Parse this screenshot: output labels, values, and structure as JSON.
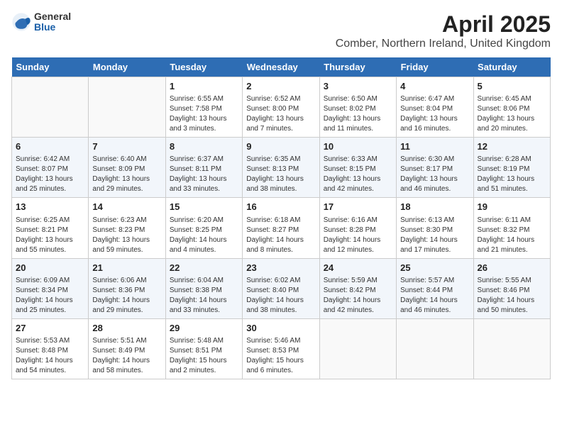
{
  "header": {
    "logo_general": "General",
    "logo_blue": "Blue",
    "title": "April 2025",
    "subtitle": "Comber, Northern Ireland, United Kingdom"
  },
  "days_of_week": [
    "Sunday",
    "Monday",
    "Tuesday",
    "Wednesday",
    "Thursday",
    "Friday",
    "Saturday"
  ],
  "weeks": [
    [
      {
        "day": "",
        "info": ""
      },
      {
        "day": "",
        "info": ""
      },
      {
        "day": "1",
        "info": "Sunrise: 6:55 AM\nSunset: 7:58 PM\nDaylight: 13 hours and 3 minutes."
      },
      {
        "day": "2",
        "info": "Sunrise: 6:52 AM\nSunset: 8:00 PM\nDaylight: 13 hours and 7 minutes."
      },
      {
        "day": "3",
        "info": "Sunrise: 6:50 AM\nSunset: 8:02 PM\nDaylight: 13 hours and 11 minutes."
      },
      {
        "day": "4",
        "info": "Sunrise: 6:47 AM\nSunset: 8:04 PM\nDaylight: 13 hours and 16 minutes."
      },
      {
        "day": "5",
        "info": "Sunrise: 6:45 AM\nSunset: 8:06 PM\nDaylight: 13 hours and 20 minutes."
      }
    ],
    [
      {
        "day": "6",
        "info": "Sunrise: 6:42 AM\nSunset: 8:07 PM\nDaylight: 13 hours and 25 minutes."
      },
      {
        "day": "7",
        "info": "Sunrise: 6:40 AM\nSunset: 8:09 PM\nDaylight: 13 hours and 29 minutes."
      },
      {
        "day": "8",
        "info": "Sunrise: 6:37 AM\nSunset: 8:11 PM\nDaylight: 13 hours and 33 minutes."
      },
      {
        "day": "9",
        "info": "Sunrise: 6:35 AM\nSunset: 8:13 PM\nDaylight: 13 hours and 38 minutes."
      },
      {
        "day": "10",
        "info": "Sunrise: 6:33 AM\nSunset: 8:15 PM\nDaylight: 13 hours and 42 minutes."
      },
      {
        "day": "11",
        "info": "Sunrise: 6:30 AM\nSunset: 8:17 PM\nDaylight: 13 hours and 46 minutes."
      },
      {
        "day": "12",
        "info": "Sunrise: 6:28 AM\nSunset: 8:19 PM\nDaylight: 13 hours and 51 minutes."
      }
    ],
    [
      {
        "day": "13",
        "info": "Sunrise: 6:25 AM\nSunset: 8:21 PM\nDaylight: 13 hours and 55 minutes."
      },
      {
        "day": "14",
        "info": "Sunrise: 6:23 AM\nSunset: 8:23 PM\nDaylight: 13 hours and 59 minutes."
      },
      {
        "day": "15",
        "info": "Sunrise: 6:20 AM\nSunset: 8:25 PM\nDaylight: 14 hours and 4 minutes."
      },
      {
        "day": "16",
        "info": "Sunrise: 6:18 AM\nSunset: 8:27 PM\nDaylight: 14 hours and 8 minutes."
      },
      {
        "day": "17",
        "info": "Sunrise: 6:16 AM\nSunset: 8:28 PM\nDaylight: 14 hours and 12 minutes."
      },
      {
        "day": "18",
        "info": "Sunrise: 6:13 AM\nSunset: 8:30 PM\nDaylight: 14 hours and 17 minutes."
      },
      {
        "day": "19",
        "info": "Sunrise: 6:11 AM\nSunset: 8:32 PM\nDaylight: 14 hours and 21 minutes."
      }
    ],
    [
      {
        "day": "20",
        "info": "Sunrise: 6:09 AM\nSunset: 8:34 PM\nDaylight: 14 hours and 25 minutes."
      },
      {
        "day": "21",
        "info": "Sunrise: 6:06 AM\nSunset: 8:36 PM\nDaylight: 14 hours and 29 minutes."
      },
      {
        "day": "22",
        "info": "Sunrise: 6:04 AM\nSunset: 8:38 PM\nDaylight: 14 hours and 33 minutes."
      },
      {
        "day": "23",
        "info": "Sunrise: 6:02 AM\nSunset: 8:40 PM\nDaylight: 14 hours and 38 minutes."
      },
      {
        "day": "24",
        "info": "Sunrise: 5:59 AM\nSunset: 8:42 PM\nDaylight: 14 hours and 42 minutes."
      },
      {
        "day": "25",
        "info": "Sunrise: 5:57 AM\nSunset: 8:44 PM\nDaylight: 14 hours and 46 minutes."
      },
      {
        "day": "26",
        "info": "Sunrise: 5:55 AM\nSunset: 8:46 PM\nDaylight: 14 hours and 50 minutes."
      }
    ],
    [
      {
        "day": "27",
        "info": "Sunrise: 5:53 AM\nSunset: 8:48 PM\nDaylight: 14 hours and 54 minutes."
      },
      {
        "day": "28",
        "info": "Sunrise: 5:51 AM\nSunset: 8:49 PM\nDaylight: 14 hours and 58 minutes."
      },
      {
        "day": "29",
        "info": "Sunrise: 5:48 AM\nSunset: 8:51 PM\nDaylight: 15 hours and 2 minutes."
      },
      {
        "day": "30",
        "info": "Sunrise: 5:46 AM\nSunset: 8:53 PM\nDaylight: 15 hours and 6 minutes."
      },
      {
        "day": "",
        "info": ""
      },
      {
        "day": "",
        "info": ""
      },
      {
        "day": "",
        "info": ""
      }
    ]
  ]
}
